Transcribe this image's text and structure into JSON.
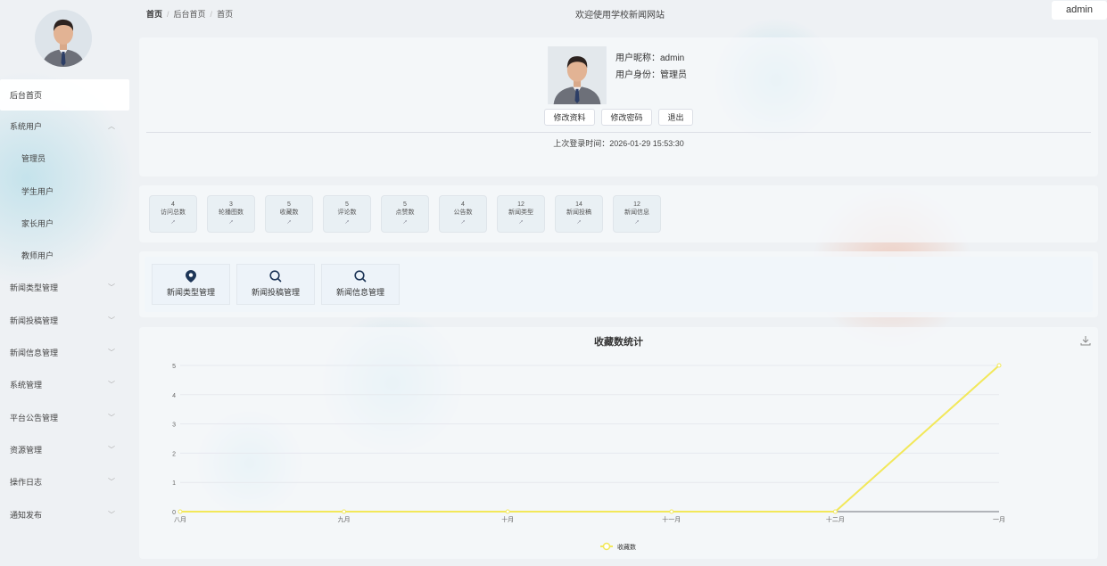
{
  "sidebar": {
    "avatar_icon": "user-avatar-photo",
    "items": [
      {
        "label": "后台首页",
        "active": true
      },
      {
        "label": "系统用户",
        "chevron": "up"
      },
      {
        "label": "管理员",
        "sub": true
      },
      {
        "label": "学生用户",
        "sub": true
      },
      {
        "label": "家长用户",
        "sub": true
      },
      {
        "label": "教师用户",
        "sub": true
      },
      {
        "label": "新闻类型管理",
        "chevron": "down"
      },
      {
        "label": "新闻投稿管理",
        "chevron": "down"
      },
      {
        "label": "新闻信息管理",
        "chevron": "down"
      },
      {
        "label": "系统管理",
        "chevron": "down"
      },
      {
        "label": "平台公告管理",
        "chevron": "down"
      },
      {
        "label": "资源管理",
        "chevron": "down"
      },
      {
        "label": "操作日志",
        "chevron": "down"
      },
      {
        "label": "通知发布",
        "chevron": "down"
      }
    ]
  },
  "header": {
    "breadcrumb": [
      "首页",
      "后台首页",
      "首页"
    ],
    "welcome": "欢迎使用学校新闻网站",
    "user": "admin"
  },
  "profile": {
    "nickname": "用户昵称：admin",
    "role": "用户身份：管理员",
    "buttons": {
      "edit": "修改资料",
      "password": "修改密码",
      "logout": "退出"
    },
    "last_login": "上次登录时间：2026-01-29 15:53:30"
  },
  "stats": [
    {
      "value": "4",
      "label": "访问总数"
    },
    {
      "value": "3",
      "label": "轮播图数"
    },
    {
      "value": "5",
      "label": "收藏数"
    },
    {
      "value": "5",
      "label": "评论数"
    },
    {
      "value": "5",
      "label": "点赞数"
    },
    {
      "value": "4",
      "label": "公告数"
    },
    {
      "value": "12",
      "label": "新闻类型"
    },
    {
      "value": "14",
      "label": "新闻投稿"
    },
    {
      "value": "12",
      "label": "新闻信息"
    }
  ],
  "stat_arrow": "↑",
  "quick_links": [
    {
      "label": "新闻类型管理",
      "icon": "location-pin-icon"
    },
    {
      "label": "新闻投稿管理",
      "icon": "search-icon"
    },
    {
      "label": "新闻信息管理",
      "icon": "search-icon"
    }
  ],
  "chart_data": {
    "type": "line",
    "title": "收藏数统计",
    "categories": [
      "八月",
      "九月",
      "十月",
      "十一月",
      "十二月",
      "一月"
    ],
    "series": [
      {
        "name": "收藏数",
        "values": [
          0,
          0,
          0,
          0,
          0,
          5
        ],
        "color": "#f2e85a"
      }
    ],
    "ylim": [
      0,
      5
    ],
    "yticks": [
      0,
      1,
      2,
      3,
      4,
      5
    ],
    "legend": "bottom",
    "grid": true
  }
}
